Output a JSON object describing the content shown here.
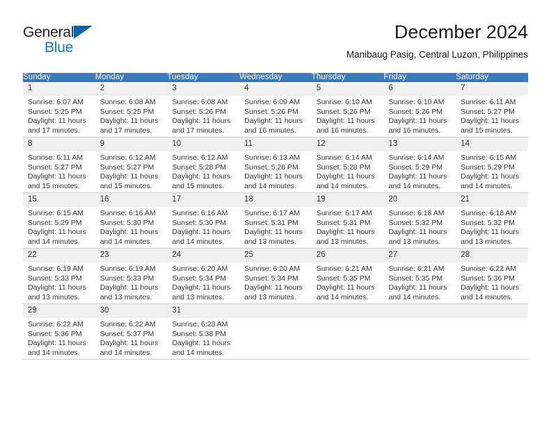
{
  "brand": {
    "name_top": "General",
    "name_bottom": "Blue",
    "accent_dark": "#231f20",
    "accent_blue": "#1278c8",
    "triangle_color": "#1063a8"
  },
  "header": {
    "title": "December 2024",
    "subtitle": "Manibaug Pasig, Central Luzon, Philippines"
  },
  "theme": {
    "header_row_bg": "#3a7abd",
    "header_row_text": "#ffffff",
    "daynum_bg": "#efefef",
    "week_separator": "#1f5fa0",
    "cell_border": "#cfcfcf"
  },
  "weekday_headers": [
    "Sunday",
    "Monday",
    "Tuesday",
    "Wednesday",
    "Thursday",
    "Friday",
    "Saturday"
  ],
  "weeks": [
    [
      {
        "day": "1",
        "sunrise": "Sunrise: 6:07 AM",
        "sunset": "Sunset: 5:25 PM",
        "daylight_line1": "Daylight: 11 hours",
        "daylight_line2": "and 17 minutes."
      },
      {
        "day": "2",
        "sunrise": "Sunrise: 6:08 AM",
        "sunset": "Sunset: 5:25 PM",
        "daylight_line1": "Daylight: 11 hours",
        "daylight_line2": "and 17 minutes."
      },
      {
        "day": "3",
        "sunrise": "Sunrise: 6:08 AM",
        "sunset": "Sunset: 5:26 PM",
        "daylight_line1": "Daylight: 11 hours",
        "daylight_line2": "and 17 minutes."
      },
      {
        "day": "4",
        "sunrise": "Sunrise: 6:09 AM",
        "sunset": "Sunset: 5:26 PM",
        "daylight_line1": "Daylight: 11 hours",
        "daylight_line2": "and 16 minutes."
      },
      {
        "day": "5",
        "sunrise": "Sunrise: 6:10 AM",
        "sunset": "Sunset: 5:26 PM",
        "daylight_line1": "Daylight: 11 hours",
        "daylight_line2": "and 16 minutes."
      },
      {
        "day": "6",
        "sunrise": "Sunrise: 6:10 AM",
        "sunset": "Sunset: 5:26 PM",
        "daylight_line1": "Daylight: 11 hours",
        "daylight_line2": "and 16 minutes."
      },
      {
        "day": "7",
        "sunrise": "Sunrise: 6:11 AM",
        "sunset": "Sunset: 5:27 PM",
        "daylight_line1": "Daylight: 11 hours",
        "daylight_line2": "and 15 minutes."
      }
    ],
    [
      {
        "day": "8",
        "sunrise": "Sunrise: 6:11 AM",
        "sunset": "Sunset: 5:27 PM",
        "daylight_line1": "Daylight: 11 hours",
        "daylight_line2": "and 15 minutes."
      },
      {
        "day": "9",
        "sunrise": "Sunrise: 6:12 AM",
        "sunset": "Sunset: 5:27 PM",
        "daylight_line1": "Daylight: 11 hours",
        "daylight_line2": "and 15 minutes."
      },
      {
        "day": "10",
        "sunrise": "Sunrise: 6:12 AM",
        "sunset": "Sunset: 5:28 PM",
        "daylight_line1": "Daylight: 11 hours",
        "daylight_line2": "and 15 minutes."
      },
      {
        "day": "11",
        "sunrise": "Sunrise: 6:13 AM",
        "sunset": "Sunset: 5:28 PM",
        "daylight_line1": "Daylight: 11 hours",
        "daylight_line2": "and 14 minutes."
      },
      {
        "day": "12",
        "sunrise": "Sunrise: 6:14 AM",
        "sunset": "Sunset: 5:28 PM",
        "daylight_line1": "Daylight: 11 hours",
        "daylight_line2": "and 14 minutes."
      },
      {
        "day": "13",
        "sunrise": "Sunrise: 6:14 AM",
        "sunset": "Sunset: 5:29 PM",
        "daylight_line1": "Daylight: 11 hours",
        "daylight_line2": "and 14 minutes."
      },
      {
        "day": "14",
        "sunrise": "Sunrise: 6:15 AM",
        "sunset": "Sunset: 5:29 PM",
        "daylight_line1": "Daylight: 11 hours",
        "daylight_line2": "and 14 minutes."
      }
    ],
    [
      {
        "day": "15",
        "sunrise": "Sunrise: 6:15 AM",
        "sunset": "Sunset: 5:29 PM",
        "daylight_line1": "Daylight: 11 hours",
        "daylight_line2": "and 14 minutes."
      },
      {
        "day": "16",
        "sunrise": "Sunrise: 6:16 AM",
        "sunset": "Sunset: 5:30 PM",
        "daylight_line1": "Daylight: 11 hours",
        "daylight_line2": "and 14 minutes."
      },
      {
        "day": "17",
        "sunrise": "Sunrise: 6:16 AM",
        "sunset": "Sunset: 5:30 PM",
        "daylight_line1": "Daylight: 11 hours",
        "daylight_line2": "and 14 minutes."
      },
      {
        "day": "18",
        "sunrise": "Sunrise: 6:17 AM",
        "sunset": "Sunset: 5:31 PM",
        "daylight_line1": "Daylight: 11 hours",
        "daylight_line2": "and 13 minutes."
      },
      {
        "day": "19",
        "sunrise": "Sunrise: 6:17 AM",
        "sunset": "Sunset: 5:31 PM",
        "daylight_line1": "Daylight: 11 hours",
        "daylight_line2": "and 13 minutes."
      },
      {
        "day": "20",
        "sunrise": "Sunrise: 6:18 AM",
        "sunset": "Sunset: 5:32 PM",
        "daylight_line1": "Daylight: 11 hours",
        "daylight_line2": "and 13 minutes."
      },
      {
        "day": "21",
        "sunrise": "Sunrise: 6:18 AM",
        "sunset": "Sunset: 5:32 PM",
        "daylight_line1": "Daylight: 11 hours",
        "daylight_line2": "and 13 minutes."
      }
    ],
    [
      {
        "day": "22",
        "sunrise": "Sunrise: 6:19 AM",
        "sunset": "Sunset: 5:33 PM",
        "daylight_line1": "Daylight: 11 hours",
        "daylight_line2": "and 13 minutes."
      },
      {
        "day": "23",
        "sunrise": "Sunrise: 6:19 AM",
        "sunset": "Sunset: 5:33 PM",
        "daylight_line1": "Daylight: 11 hours",
        "daylight_line2": "and 13 minutes."
      },
      {
        "day": "24",
        "sunrise": "Sunrise: 6:20 AM",
        "sunset": "Sunset: 5:34 PM",
        "daylight_line1": "Daylight: 11 hours",
        "daylight_line2": "and 13 minutes."
      },
      {
        "day": "25",
        "sunrise": "Sunrise: 6:20 AM",
        "sunset": "Sunset: 5:34 PM",
        "daylight_line1": "Daylight: 11 hours",
        "daylight_line2": "and 13 minutes."
      },
      {
        "day": "26",
        "sunrise": "Sunrise: 6:21 AM",
        "sunset": "Sunset: 5:35 PM",
        "daylight_line1": "Daylight: 11 hours",
        "daylight_line2": "and 14 minutes."
      },
      {
        "day": "27",
        "sunrise": "Sunrise: 6:21 AM",
        "sunset": "Sunset: 5:35 PM",
        "daylight_line1": "Daylight: 11 hours",
        "daylight_line2": "and 14 minutes."
      },
      {
        "day": "28",
        "sunrise": "Sunrise: 6:22 AM",
        "sunset": "Sunset: 5:36 PM",
        "daylight_line1": "Daylight: 11 hours",
        "daylight_line2": "and 14 minutes."
      }
    ],
    [
      {
        "day": "29",
        "sunrise": "Sunrise: 6:22 AM",
        "sunset": "Sunset: 5:36 PM",
        "daylight_line1": "Daylight: 11 hours",
        "daylight_line2": "and 14 minutes."
      },
      {
        "day": "30",
        "sunrise": "Sunrise: 6:22 AM",
        "sunset": "Sunset: 5:37 PM",
        "daylight_line1": "Daylight: 11 hours",
        "daylight_line2": "and 14 minutes."
      },
      {
        "day": "31",
        "sunrise": "Sunrise: 6:23 AM",
        "sunset": "Sunset: 5:38 PM",
        "daylight_line1": "Daylight: 11 hours",
        "daylight_line2": "and 14 minutes."
      },
      {
        "day": "",
        "sunrise": "",
        "sunset": "",
        "daylight_line1": "",
        "daylight_line2": ""
      },
      {
        "day": "",
        "sunrise": "",
        "sunset": "",
        "daylight_line1": "",
        "daylight_line2": ""
      },
      {
        "day": "",
        "sunrise": "",
        "sunset": "",
        "daylight_line1": "",
        "daylight_line2": ""
      },
      {
        "day": "",
        "sunrise": "",
        "sunset": "",
        "daylight_line1": "",
        "daylight_line2": ""
      }
    ]
  ]
}
